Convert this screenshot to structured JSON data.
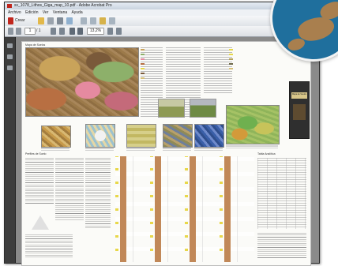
{
  "window": {
    "title": "sv_1078_Lithos_Giga_map_10.pdf - Adobe Acrobat Pro"
  },
  "menubar": {
    "items": [
      "Archivo",
      "Edición",
      "Ver",
      "Ventana",
      "Ayuda"
    ]
  },
  "toolbar": {
    "create_label": "Crear",
    "page_current": "1",
    "page_total": "/ 1",
    "zoom_value": "13,2%"
  },
  "document": {
    "section_top_title": "Mapa de Suelos",
    "section_bottom_title": "Perfiles de Suelo",
    "right_panel_title": "Tabla Analítica",
    "cover_title": "Mapa de Suelos"
  },
  "colors": {
    "window_chrome": "#6b6b6b",
    "sidebar": "#3d3d3d",
    "page": "#fbfbf8",
    "ocean": "#1f6f9d",
    "land": "#a97f4e",
    "map_base": "#9c7a4a"
  },
  "icons": {
    "app": "acrobat-icon",
    "create": "create-pdf-icon",
    "open": "folder-icon",
    "print": "printer-icon",
    "email": "mail-icon",
    "prev": "arrow-up-icon",
    "next": "arrow-down-icon",
    "zoom_out": "minus-icon",
    "zoom_in": "plus-icon",
    "hand": "hand-tool-icon"
  }
}
